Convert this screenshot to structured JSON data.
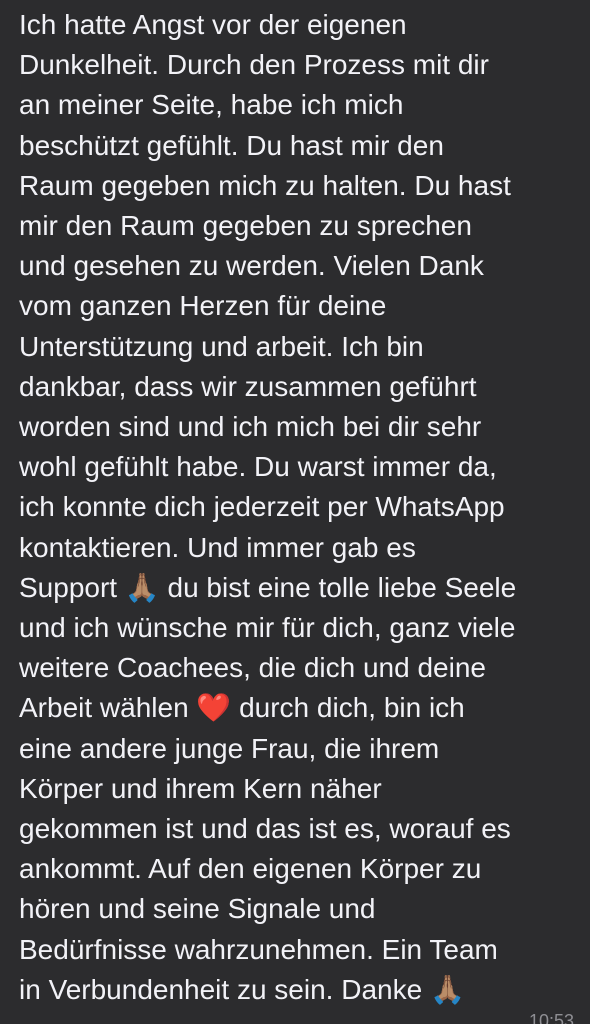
{
  "chat": {
    "message_text": "Ich hatte Angst vor der eigenen\nDunkelheit. Durch den Prozess mit dir\nan meiner Seite, habe ich mich\nbeschützt gefühlt. Du hast mir den\nRaum gegeben mich zu halten. Du hast\nmir den Raum gegeben zu sprechen\nund gesehen zu werden. Vielen Dank\nvom ganzen Herzen für deine\nUnterstützung und arbeit. Ich bin\ndankbar, dass wir zusammen geführt\nworden sind und ich mich bei dir sehr\nwohl gefühlt habe. Du warst immer da,\nich konnte dich jederzeit per WhatsApp\nkontaktieren. Und immer gab es\nSupport 🙏🏽 du bist eine tolle liebe Seele\nund ich wünsche mir für dich, ganz viele\nweitere Coachees, die dich und deine\nArbeit wählen ❤️ durch dich, bin ich\neine andere junge Frau, die ihrem\nKörper und ihrem Kern näher\ngekommen ist und das ist es, worauf es\nankommt. Auf den eigenen Körper zu\nhören und seine Signale und\nBedürfnisse wahrzunehmen. Ein Team\nin Verbundenheit zu sein. Danke 🙏🏽",
    "timestamp": "10:53"
  },
  "colors": {
    "bubble_background": "#2c2c2e",
    "text": "#f2f2f7",
    "timestamp": "#8e8e93"
  }
}
